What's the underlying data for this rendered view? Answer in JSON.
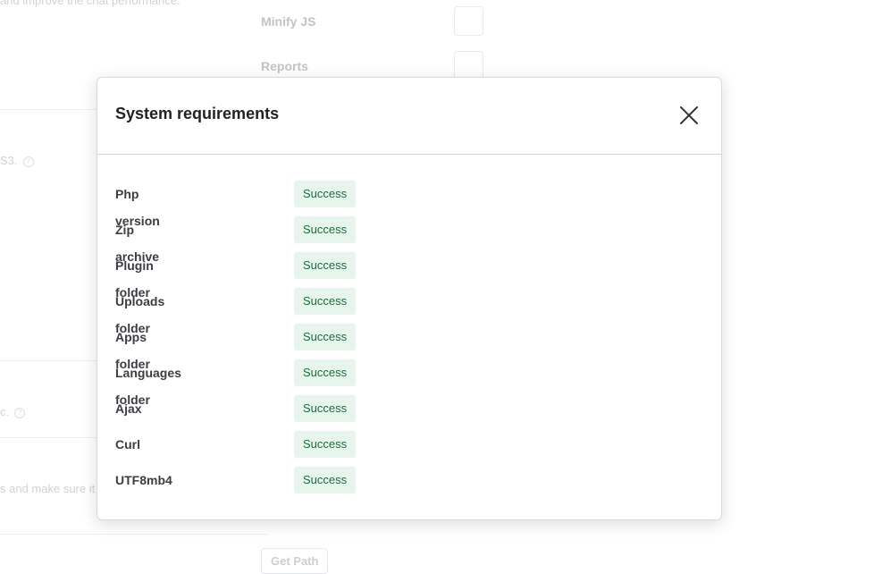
{
  "background": {
    "top_text": "and improve the chat performance.",
    "minify_label": "Minify JS",
    "reports_label": "Reports",
    "s3_text": "S3.",
    "c_text": "c.",
    "make_sure_text": "s and make sure it",
    "get_path_button": "Get Path",
    "help_glyph": "?"
  },
  "modal": {
    "title": "System requirements",
    "close_label": "Close",
    "rows": [
      {
        "label": "Php version",
        "status": "Success"
      },
      {
        "label": "Zip archive",
        "status": "Success"
      },
      {
        "label": "Plugin folder",
        "status": "Success"
      },
      {
        "label": "Uploads folder",
        "status": "Success"
      },
      {
        "label": "Apps folder",
        "status": "Success"
      },
      {
        "label": "Languages folder",
        "status": "Success"
      },
      {
        "label": "Ajax",
        "status": "Success"
      },
      {
        "label": "Curl",
        "status": "Success"
      },
      {
        "label": "UTF8mb4",
        "status": "Success"
      }
    ]
  },
  "colors": {
    "success_bg": "#e8f5ec",
    "success_text": "#1d6b3c"
  }
}
